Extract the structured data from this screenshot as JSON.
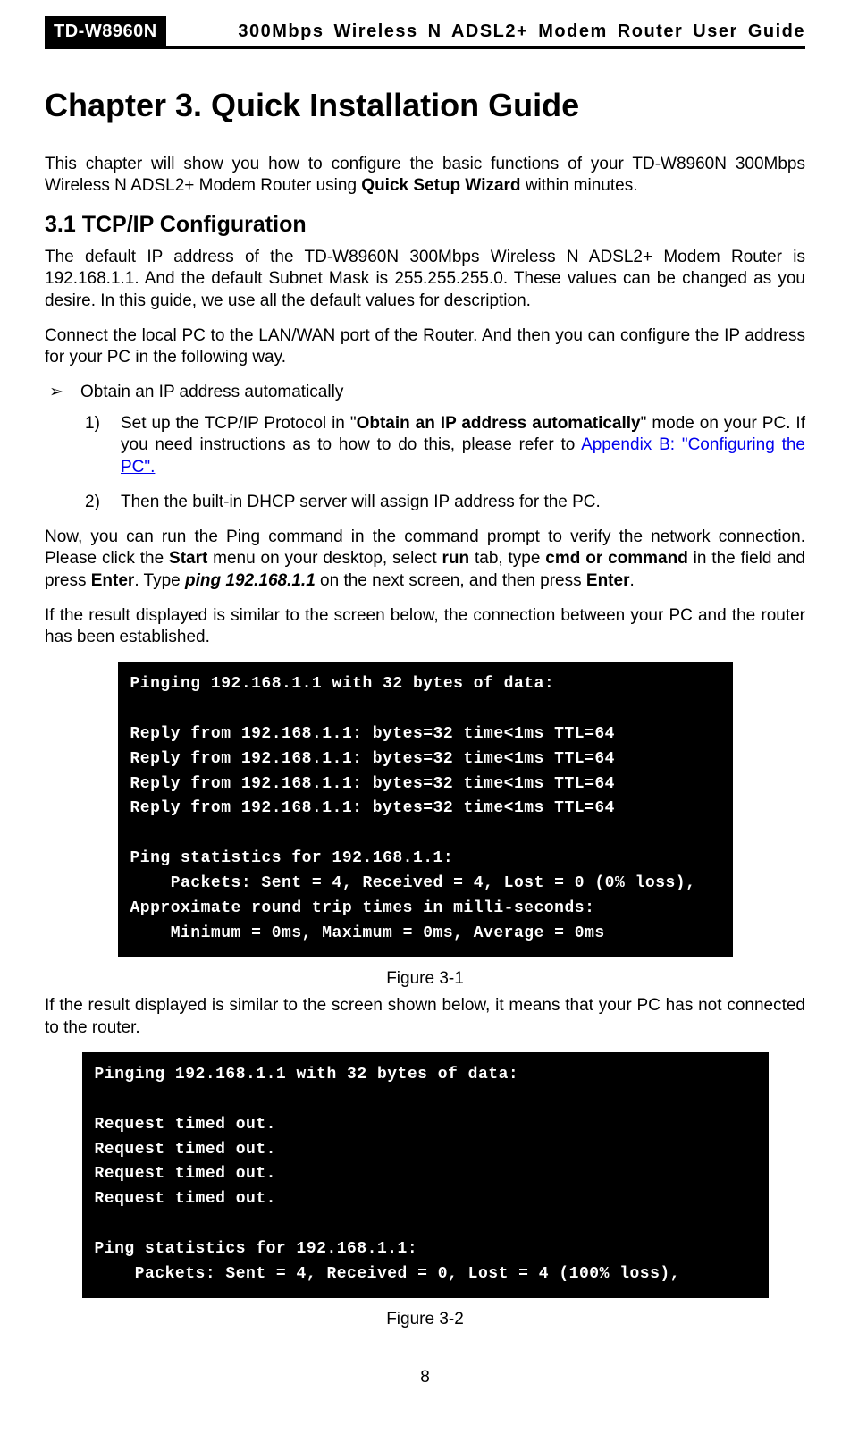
{
  "header": {
    "model": "TD-W8960N",
    "guide_title": "300Mbps Wireless N ADSL2+ Modem Router User Guide"
  },
  "chapter": {
    "title": "Chapter 3. Quick Installation Guide",
    "intro_pre": "This chapter will show you how to configure the basic functions of your TD-W8960N 300Mbps Wireless N ADSL2+ Modem Router using ",
    "intro_bold": "Quick Setup Wizard",
    "intro_post": " within minutes."
  },
  "section": {
    "title": "3.1  TCP/IP Configuration",
    "p1": "The default IP address of the TD-W8960N 300Mbps Wireless N ADSL2+ Modem Router is 192.168.1.1. And the default Subnet Mask is 255.255.255.0. These values can be changed as you desire. In this guide, we use all the default values for description.",
    "p2": "Connect the local PC to the LAN/WAN port of the Router. And then you can configure the IP address for your PC in the following way.",
    "bullet_marker": "➢",
    "bullet_text": "Obtain an IP address automatically",
    "step1_num": "1)",
    "step1_pre": "Set up the TCP/IP Protocol in \"",
    "step1_bold": "Obtain an IP address automatically",
    "step1_mid": "\" mode on your PC. If you need instructions as to how to do this, please refer to ",
    "step1_link": "Appendix B: \"Configuring the PC\".",
    "step2_num": "2)",
    "step2_text": "Then the built-in DHCP server will assign IP address for the PC.",
    "p3_a": "Now, you can run the Ping command in the command prompt to verify the network connection. Please click the ",
    "p3_b": "Start",
    "p3_c": " menu on your desktop, select ",
    "p3_d": "run",
    "p3_e": " tab, type ",
    "p3_f": "cmd or command",
    "p3_g": " in the field and press ",
    "p3_h": "Enter",
    "p3_i": ". Type ",
    "p3_j": "ping 192.168.1.1",
    "p3_k": " on the next screen, and then press ",
    "p3_l": "Enter",
    "p3_m": ".",
    "p4": "If the result displayed is similar to the screen below, the connection between your PC and the router has been established."
  },
  "terminal1": "Pinging 192.168.1.1 with 32 bytes of data:\n\nReply from 192.168.1.1: bytes=32 time<1ms TTL=64\nReply from 192.168.1.1: bytes=32 time<1ms TTL=64\nReply from 192.168.1.1: bytes=32 time<1ms TTL=64\nReply from 192.168.1.1: bytes=32 time<1ms TTL=64\n\nPing statistics for 192.168.1.1:\n    Packets: Sent = 4, Received = 4, Lost = 0 (0% loss),\nApproximate round trip times in milli-seconds:\n    Minimum = 0ms, Maximum = 0ms, Average = 0ms",
  "fig1": "Figure 3-1",
  "p5": "If the result displayed is similar to the screen shown below, it means that your PC has not connected to the router.",
  "terminal2": "Pinging 192.168.1.1 with 32 bytes of data:\n\nRequest timed out.\nRequest timed out.\nRequest timed out.\nRequest timed out.\n\nPing statistics for 192.168.1.1:\n    Packets: Sent = 4, Received = 0, Lost = 4 (100% loss),",
  "fig2": "Figure 3-2",
  "page_number": "8"
}
